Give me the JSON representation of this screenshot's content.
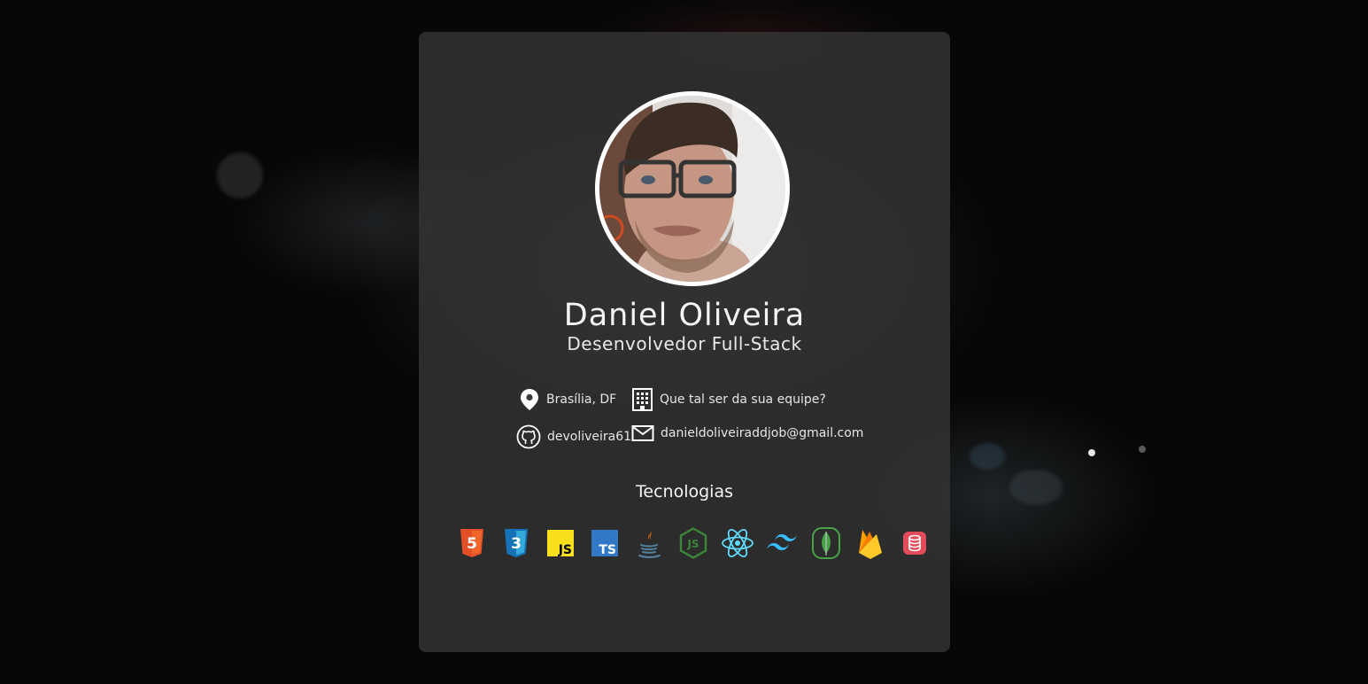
{
  "profile": {
    "name": "Daniel Oliveira",
    "role": "Desenvolvedor Full-Stack"
  },
  "info": {
    "location": "Brasília, DF",
    "work": "Que tal ser da sua equipe?",
    "github": "devoliveira61",
    "email": "danieldoliveiraddjob@gmail.com"
  },
  "technologies": {
    "title": "Tecnologias",
    "items": [
      {
        "name": "HTML5",
        "icon": "html5-icon",
        "color": "#E34F26",
        "text": "5"
      },
      {
        "name": "CSS3",
        "icon": "css3-icon",
        "color": "#1572B6",
        "text": "3"
      },
      {
        "name": "JavaScript",
        "icon": "javascript-icon",
        "color": "#F7DF1E",
        "text": "JS"
      },
      {
        "name": "TypeScript",
        "icon": "typescript-icon",
        "color": "#3178C6",
        "text": "TS"
      },
      {
        "name": "Java",
        "icon": "java-icon",
        "color": "#5382A1"
      },
      {
        "name": "Node.js",
        "icon": "nodejs-icon",
        "color": "#3C873A",
        "text": "JS"
      },
      {
        "name": "React",
        "icon": "react-icon",
        "color": "#61DAFB"
      },
      {
        "name": "Tailwind CSS",
        "icon": "tailwind-icon",
        "color": "#38BDF8"
      },
      {
        "name": "MongoDB",
        "icon": "mongodb-icon",
        "color": "#47A248"
      },
      {
        "name": "Firebase",
        "icon": "firebase-icon",
        "color": "#FFCA28"
      },
      {
        "name": "Database",
        "icon": "database-icon",
        "color": "#E14B5A"
      }
    ]
  },
  "carousel": {
    "pages": 2,
    "active": 0
  }
}
